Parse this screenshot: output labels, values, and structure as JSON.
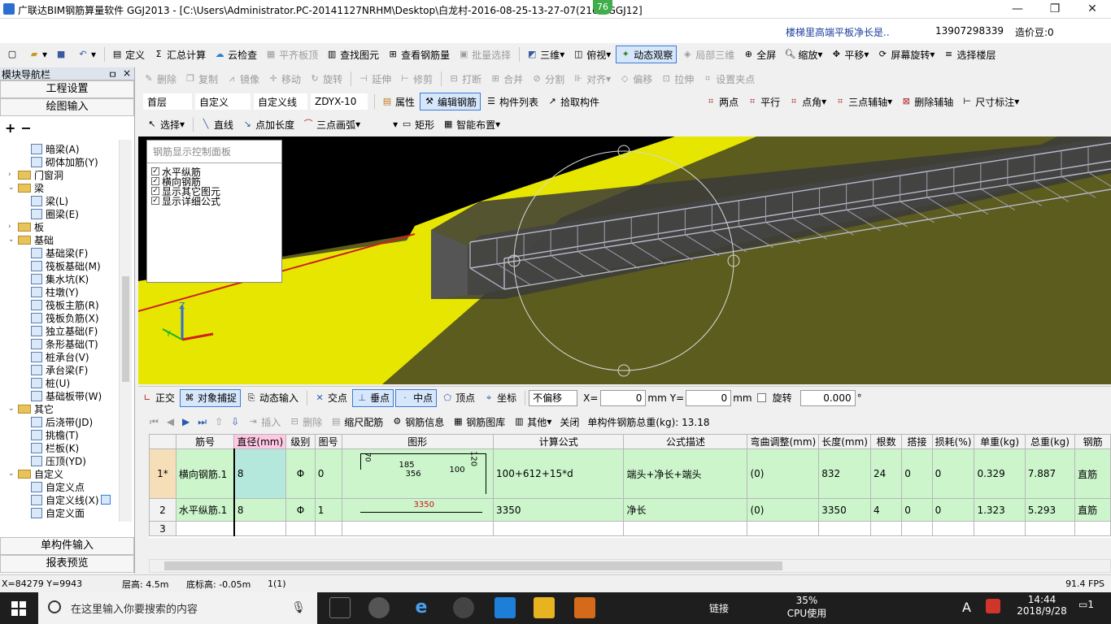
{
  "titlebar": {
    "title": "广联达BIM钢筋算量软件 GGJ2013 - [C:\\Users\\Administrator.PC-20141127NRHM\\Desktop\\白龙村-2016-08-25-13-27-07(2167-GGJ12]",
    "badge": "76",
    "minimize": "—",
    "restore": "❐",
    "close": "✕"
  },
  "menubar": {
    "notice": "楼梯里高端平板净长是..",
    "phone": "13907298339",
    "bean": "造价豆:0"
  },
  "toolbar1": {
    "items": [
      "定义",
      "汇总计算",
      "云检查",
      "平齐板顶",
      "查找图元",
      "查看钢筋量",
      "批量选择",
      "三维",
      "俯视",
      "动态观察",
      "局部三维",
      "全屏",
      "缩放",
      "平移",
      "屏幕旋转",
      "选择楼层"
    ]
  },
  "toolbar2": {
    "items": [
      "删除",
      "复制",
      "镜像",
      "移动",
      "旋转",
      "延伸",
      "修剪",
      "打断",
      "合并",
      "分割",
      "对齐",
      "偏移",
      "拉伸",
      "设置夹点"
    ]
  },
  "toolbar3": {
    "floor": "首层",
    "category": "自定义",
    "subcategory": "自定义线",
    "element": "ZDYX-10",
    "props": "属性",
    "edit_rebar": "编辑钢筋",
    "list": "构件列表",
    "pick": "拾取构件",
    "axis_items": [
      "两点",
      "平行",
      "点角",
      "三点辅轴",
      "删除辅轴",
      "尺寸标注"
    ]
  },
  "toolbar4": {
    "items": [
      "选择",
      "直线",
      "点加长度",
      "三点画弧",
      "矩形",
      "智能布置"
    ]
  },
  "nav": {
    "header": "模块导航栏",
    "pin": "ㅁ",
    "close": "×",
    "top_buttons": [
      "工程设置",
      "绘图输入"
    ],
    "add": "+",
    "remove": "−",
    "bottom_buttons": [
      "单构件输入",
      "报表预览"
    ],
    "tree": [
      {
        "label": "暗梁(A)",
        "level": 2,
        "type": "item"
      },
      {
        "label": "砌体加筋(Y)",
        "level": 2,
        "type": "item"
      },
      {
        "label": "门窗洞",
        "level": 1,
        "type": "folder",
        "exp": "›"
      },
      {
        "label": "梁",
        "level": 1,
        "type": "folder",
        "exp": "⌄"
      },
      {
        "label": "梁(L)",
        "level": 2,
        "type": "item"
      },
      {
        "label": "圈梁(E)",
        "level": 2,
        "type": "item"
      },
      {
        "label": "板",
        "level": 1,
        "type": "folder",
        "exp": "›"
      },
      {
        "label": "基础",
        "level": 1,
        "type": "folder",
        "exp": "⌄"
      },
      {
        "label": "基础梁(F)",
        "level": 2,
        "type": "item"
      },
      {
        "label": "筏板基础(M)",
        "level": 2,
        "type": "item"
      },
      {
        "label": "集水坑(K)",
        "level": 2,
        "type": "item"
      },
      {
        "label": "柱墩(Y)",
        "level": 2,
        "type": "item"
      },
      {
        "label": "筏板主筋(R)",
        "level": 2,
        "type": "item"
      },
      {
        "label": "筏板负筋(X)",
        "level": 2,
        "type": "item"
      },
      {
        "label": "独立基础(F)",
        "level": 2,
        "type": "item"
      },
      {
        "label": "条形基础(T)",
        "level": 2,
        "type": "item"
      },
      {
        "label": "桩承台(V)",
        "level": 2,
        "type": "item"
      },
      {
        "label": "承台梁(F)",
        "level": 2,
        "type": "item"
      },
      {
        "label": "桩(U)",
        "level": 2,
        "type": "item"
      },
      {
        "label": "基础板带(W)",
        "level": 2,
        "type": "item"
      },
      {
        "label": "其它",
        "level": 1,
        "type": "folder",
        "exp": "⌄"
      },
      {
        "label": "后浇带(JD)",
        "level": 2,
        "type": "item"
      },
      {
        "label": "挑檐(T)",
        "level": 2,
        "type": "item"
      },
      {
        "label": "栏板(K)",
        "level": 2,
        "type": "item"
      },
      {
        "label": "压顶(YD)",
        "level": 2,
        "type": "item"
      },
      {
        "label": "自定义",
        "level": 1,
        "type": "folder",
        "exp": "⌄"
      },
      {
        "label": "自定义点",
        "level": 2,
        "type": "item"
      },
      {
        "label": "自定义线(X)",
        "level": 2,
        "type": "item",
        "selected": true
      },
      {
        "label": "自定义面",
        "level": 2,
        "type": "item"
      }
    ]
  },
  "rebar_panel": {
    "title": "钢筋显示控制面板",
    "options": [
      "水平纵筋",
      "横向钢筋",
      "显示其它图元",
      "显示详细公式"
    ]
  },
  "snapbar": {
    "items": [
      "正交",
      "对象捕捉",
      "动态输入",
      "交点",
      "垂点",
      "中点",
      "顶点",
      "坐标"
    ],
    "offset_mode": "不偏移",
    "x_label": "X=",
    "x_value": "0",
    "mm1": "mm",
    "y_label": "Y=",
    "y_value": "0",
    "mm2": "mm",
    "rotate_label": "旋转",
    "rotate_value": "0.000",
    "deg": "°"
  },
  "table_toolbar": {
    "items": [
      "插入",
      "删除",
      "缩尺配筋",
      "钢筋信息",
      "钢筋图库",
      "其他",
      "关闭"
    ],
    "total": "单构件钢筋总重(kg): 13.18"
  },
  "table": {
    "headers": [
      "筋号",
      "直径(mm)",
      "级别",
      "图号",
      "图形",
      "计算公式",
      "公式描述",
      "弯曲调整(mm)",
      "长度(mm)",
      "根数",
      "搭接",
      "损耗(%)",
      "单重(kg)",
      "总重(kg)",
      "钢筋"
    ],
    "rows": [
      {
        "idx": "1*",
        "name": "横向钢筋.1",
        "dia": "8",
        "grade": "Φ",
        "fig": "0",
        "shape_a": "70",
        "shape_b": "185",
        "shape_c": "356",
        "shape_d": "100",
        "shape_e": "120",
        "formula": "100+612+15*d",
        "desc": "端头+净长+端头",
        "bend": "(0)",
        "len": "832",
        "count": "24",
        "lap": "0",
        "loss": "0",
        "unit": "0.329",
        "total": "7.887",
        "type": "直筋"
      },
      {
        "idx": "2",
        "name": "水平纵筋.1",
        "dia": "8",
        "grade": "Φ",
        "fig": "1",
        "shape_a": "3350",
        "formula": "3350",
        "desc": "净长",
        "bend": "(0)",
        "len": "3350",
        "count": "4",
        "lap": "0",
        "loss": "0",
        "unit": "1.323",
        "total": "5.293",
        "type": "直筋"
      },
      {
        "idx": "3"
      }
    ]
  },
  "status": {
    "coords": "X=84279 Y=9943",
    "floor_h": "层高: 4.5m",
    "base_h": "底标高: -0.05m",
    "count": "1(1)",
    "fps": "91.4 FPS"
  },
  "taskbar": {
    "search": "在这里输入你要搜索的内容",
    "link": "链接",
    "cpu_pct": "35%",
    "cpu_label": "CPU使用",
    "ime": "A",
    "time": "14:44",
    "date": "2018/9/28",
    "notif": "1"
  },
  "colors": {
    "row_green": "#ccf5cc",
    "accent_blue": "#3a7bd5",
    "yellow": "#e6e600",
    "olive": "#5f5f1e"
  }
}
